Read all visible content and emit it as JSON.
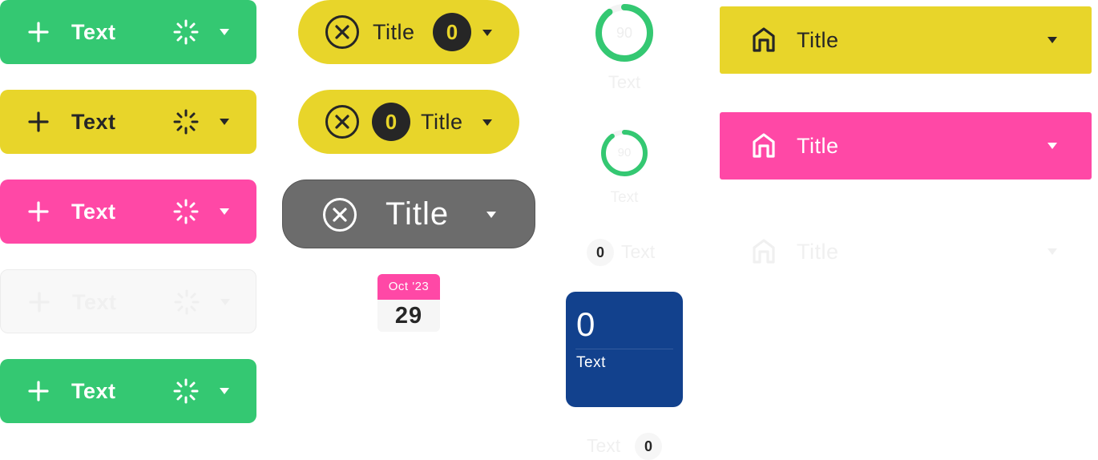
{
  "colors": {
    "green": "#34c872",
    "yellow": "#e8d52a",
    "pink": "#ff48a6",
    "disabled": "#f8f8f8",
    "gray": "#6c6c6c",
    "navy": "#12418d",
    "dark": "#262626"
  },
  "action_buttons": [
    {
      "label": "Text",
      "style": "green"
    },
    {
      "label": "Text",
      "style": "yellow"
    },
    {
      "label": "Text",
      "style": "pink"
    },
    {
      "label": "Text",
      "style": "disabled"
    },
    {
      "label": "Text",
      "style": "green"
    }
  ],
  "pills": [
    {
      "title": "Title",
      "badge": "0"
    },
    {
      "title": "Title",
      "badge": "0"
    },
    {
      "title": "Title"
    }
  ],
  "calendar": {
    "month": "Oct '23",
    "day": "29"
  },
  "progress_rings": [
    {
      "value": "90",
      "label": "Text",
      "fraction": 0.9
    },
    {
      "value": "90",
      "label": "Text",
      "fraction": 0.9
    }
  ],
  "count_row_top": {
    "badge": "0",
    "label": "Text"
  },
  "stat_card": {
    "value": "0",
    "label": "Text"
  },
  "count_row_bottom": {
    "label": "Text",
    "badge": "0"
  },
  "nav_bars": [
    {
      "title": "Title",
      "style": "yellow"
    },
    {
      "title": "Title",
      "style": "pink"
    },
    {
      "title": "Title",
      "style": "disabled"
    }
  ],
  "icons": [
    "plus-icon",
    "spinner-icon",
    "caret-down-icon",
    "close-circle-icon",
    "home-icon"
  ]
}
